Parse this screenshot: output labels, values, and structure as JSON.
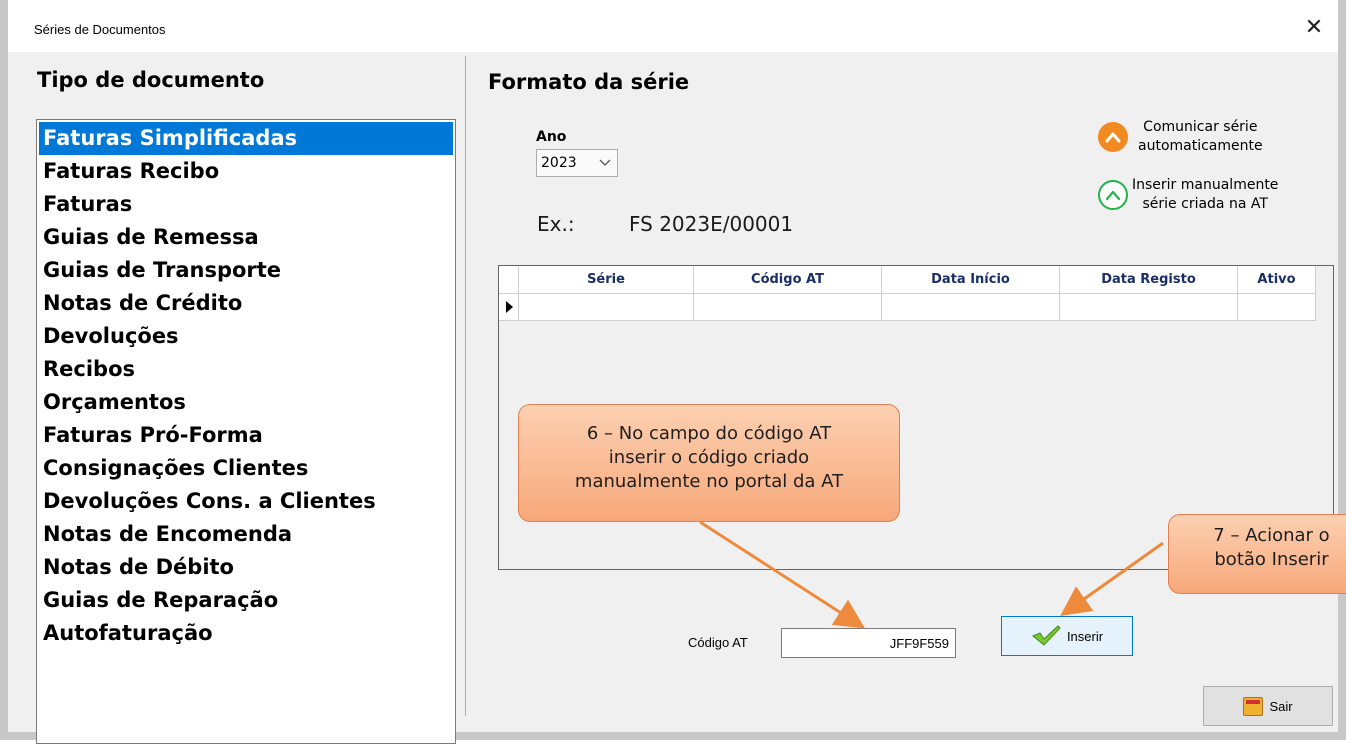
{
  "window": {
    "title": "Séries de Documentos",
    "close_glyph": "✕"
  },
  "left_panel": {
    "heading": "Tipo de documento",
    "items": [
      "Faturas Simplificadas",
      "Faturas Recibo",
      "Faturas",
      "Guias de Remessa",
      "Guias de Transporte",
      "Notas de Crédito",
      "Devoluções",
      "Recibos",
      "Orçamentos",
      "Faturas Pró-Forma",
      "Consignações Clientes",
      "Devoluções Cons. a Clientes",
      "Notas de Encomenda",
      "Notas de Débito",
      "Guias de Reparação",
      "Autofaturação"
    ],
    "selected_index": 0
  },
  "right_panel": {
    "heading": "Formato da série",
    "ano": {
      "label": "Ano",
      "value": "2023"
    },
    "example": {
      "label": "Ex.:",
      "value": "FS 2023E/00001"
    },
    "legend": {
      "auto": {
        "line1": "Comunicar série",
        "line2": "automaticamente",
        "icon": "chevron-up-filled-orange-icon",
        "color": "#f28a22"
      },
      "manual": {
        "line1": "Inserir manualmente",
        "line2": "série criada na AT",
        "icon": "chevron-up-outline-green-icon",
        "color": "#22b34a"
      }
    },
    "grid": {
      "columns": [
        "Série",
        "Código AT",
        "Data Início",
        "Data Registo",
        "Ativo"
      ],
      "rows": [
        [
          "",
          "",
          "",
          "",
          ""
        ]
      ]
    },
    "codigo_at": {
      "label": "Código AT",
      "value": "JFF9F559"
    },
    "inserir_label": "Inserir",
    "sair_label": "Sair"
  },
  "callouts": {
    "step6": {
      "line1": "6 – No campo do código AT",
      "line2": "inserir o código criado",
      "line3": "manualmente no portal da AT"
    },
    "step7": {
      "line1": "7 – Acionar o",
      "line2": "botão Inserir"
    }
  },
  "colors": {
    "selection": "#0078d7",
    "callout": "#f7a87a",
    "arrow": "#ee8a3c"
  }
}
